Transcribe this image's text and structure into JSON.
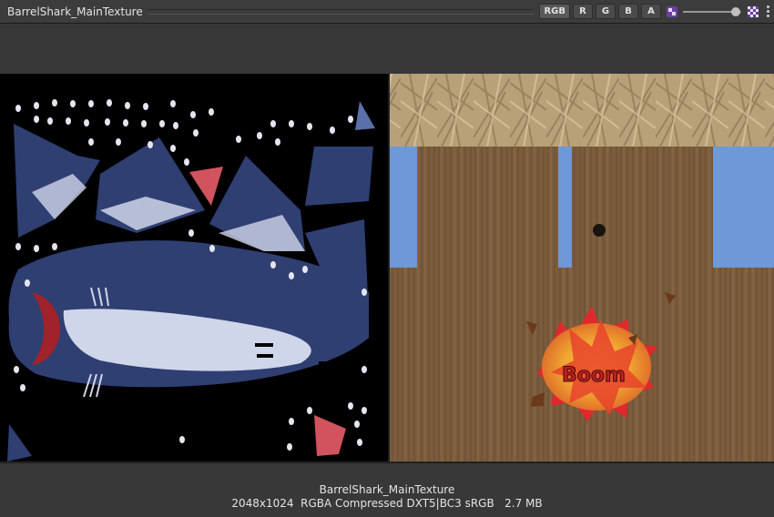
{
  "window": {
    "title": "BarrelShark_MainTexture"
  },
  "toolbar": {
    "channels": [
      {
        "label": "RGB",
        "active": true
      },
      {
        "label": "R",
        "active": false
      },
      {
        "label": "G",
        "active": false
      },
      {
        "label": "B",
        "active": false
      },
      {
        "label": "A",
        "active": false
      }
    ],
    "mip_level": 0.9,
    "icons": [
      "mip-icon",
      "checker-icon",
      "more-icon"
    ]
  },
  "preview": {
    "decal_text": "Boom"
  },
  "footer": {
    "name": "BarrelShark_MainTexture",
    "info": "2048x1024  RGBA Compressed DXT5|BC3 sRGB   2.7 MB"
  },
  "colors": {
    "shark_blue": "#2f3f72",
    "shark_belly": "#cfd6ea",
    "fin_red": "#d0535e",
    "wood": "#7a5a3a",
    "metal": "#b9a27a",
    "sky": "#6f98d8",
    "boom_yellow": "#f2b233",
    "boom_red": "#e0282d"
  }
}
